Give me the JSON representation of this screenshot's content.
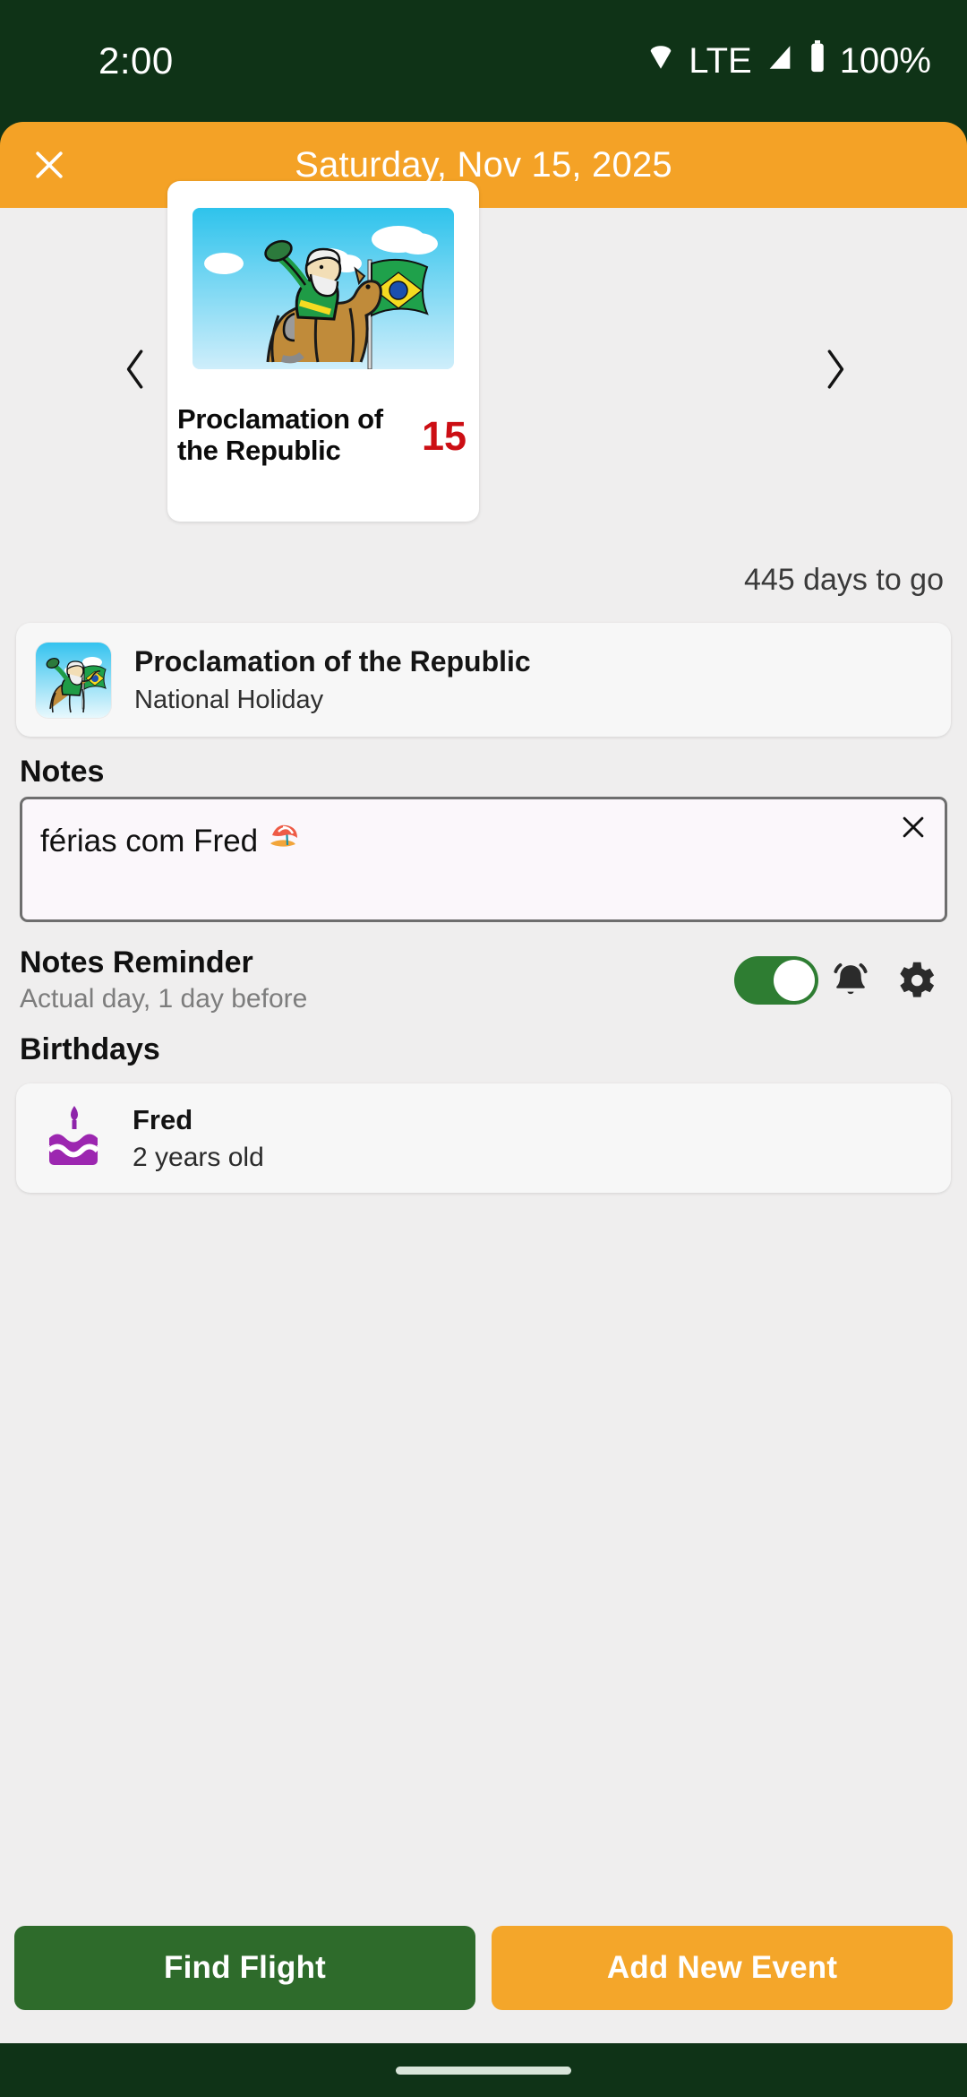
{
  "status_bar": {
    "time": "2:00",
    "network": "LTE",
    "battery": "100%",
    "icons": {
      "wifi": "wifi-icon",
      "signal": "signal-icon",
      "battery": "battery-icon"
    }
  },
  "header": {
    "close_icon": "close-icon",
    "title": "Saturday, Nov 15, 2025",
    "background": "#F4A226"
  },
  "carousel": {
    "prev_icon": "chevron-left-icon",
    "next_icon": "chevron-right-icon",
    "card": {
      "title": "Proclamation of the Republic",
      "day": "15",
      "day_color": "#CC0E14",
      "image_alt": "proclamation-illustration"
    },
    "countdown": "445 days to go"
  },
  "holiday": {
    "thumb_alt": "proclamation-thumbnail",
    "name": "Proclamation of the Republic",
    "type": "National Holiday"
  },
  "notes": {
    "label": "Notes",
    "value": "férias com Fred",
    "emoji": "⛱",
    "placeholder": "",
    "clear_icon": "close-icon"
  },
  "reminder": {
    "title": "Notes Reminder",
    "subtitle": "Actual day, 1 day before",
    "toggle_on": true,
    "toggle_color": "#2E7D32",
    "bell_icon": "bell-ring-icon",
    "settings_icon": "gear-icon"
  },
  "birthdays": {
    "label": "Birthdays",
    "items": [
      {
        "name": "Fred",
        "age": "2 years old",
        "icon": "birthday-cake-icon",
        "icon_color": "#9C27B0"
      }
    ]
  },
  "bottom_bar": {
    "find_flight": "Find Flight",
    "add_event": "Add New Event",
    "find_flight_color": "#2E6B2B",
    "add_event_color": "#F4A62A"
  }
}
